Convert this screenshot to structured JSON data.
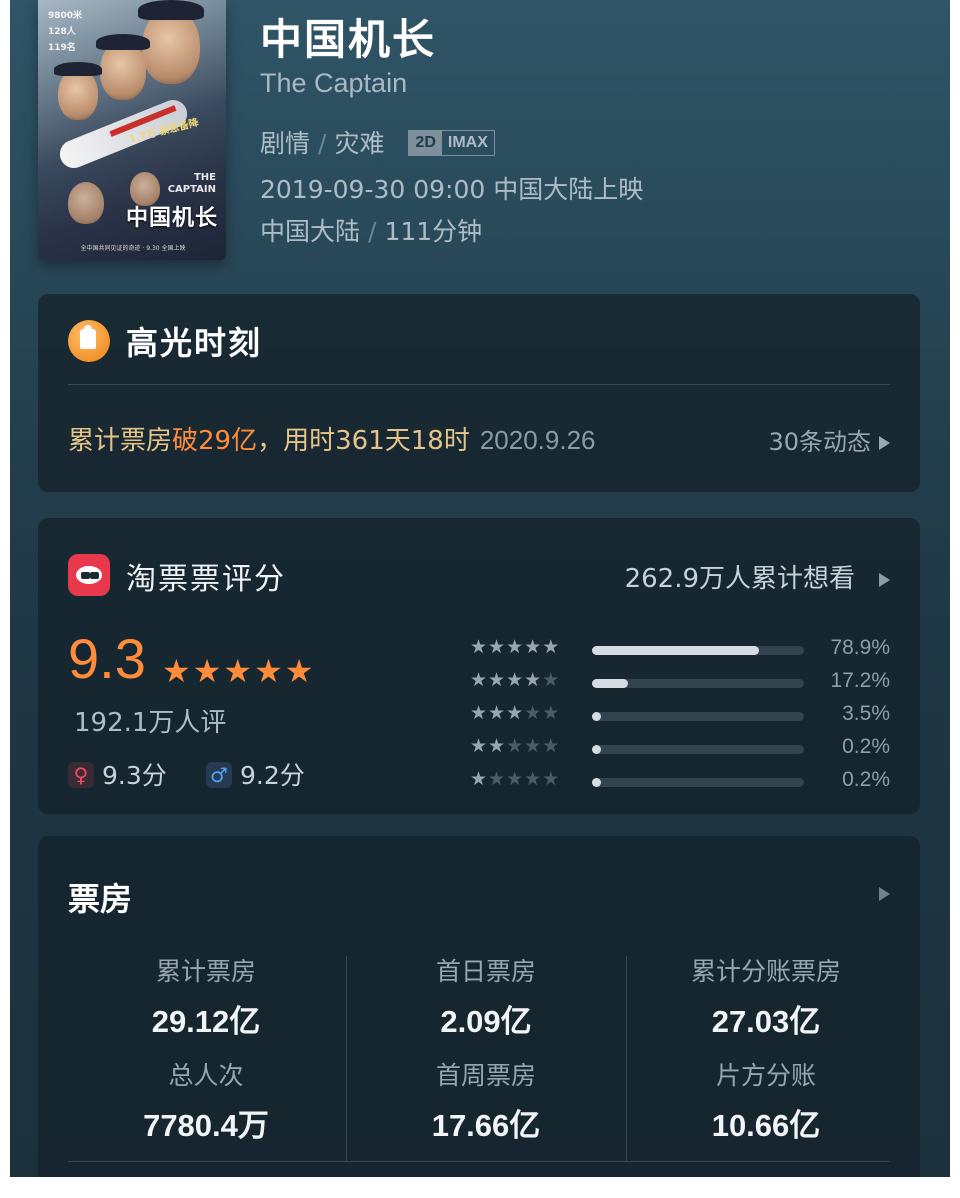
{
  "movie": {
    "title": "中国机长",
    "title_en": "The Captain",
    "genres": [
      "剧情",
      "灾难"
    ],
    "formats": [
      "2D",
      "IMAX"
    ],
    "release": "2019-09-30 09:00 中国大陆上映",
    "region": "中国大陆",
    "duration": "111分钟",
    "poster": {
      "title_cn": "中国机长",
      "title_en_line1": "THE",
      "title_en_line2": "CAPTAIN",
      "tagline": "1.7万 紧急备降",
      "side_text_1": "9800米",
      "side_text_2": "128人",
      "side_text_3": "119名",
      "bottom_text": "全中国共同见证的奇迹 · 9.30 全国上映"
    }
  },
  "highlight": {
    "title": "高光时刻",
    "prefix": "累计票房",
    "milestone": "破29亿",
    "suffix": "，用时361天18时",
    "date": "2020.9.26",
    "more": "30条动态"
  },
  "rating": {
    "title": "淘票票评分",
    "want": "262.9万人累计想看",
    "score": "9.3",
    "raters": "192.1万人评",
    "female_score": "9.3分",
    "male_score": "9.2分",
    "distribution": [
      {
        "stars": 5,
        "value": 0.789,
        "label": "78.9%"
      },
      {
        "stars": 4,
        "value": 0.172,
        "label": "17.2%"
      },
      {
        "stars": 3,
        "value": 0.035,
        "label": "3.5%"
      },
      {
        "stars": 2,
        "value": 0.002,
        "label": "0.2%"
      },
      {
        "stars": 1,
        "value": 0.002,
        "label": "0.2%"
      }
    ]
  },
  "box_office": {
    "title": "票房",
    "cells": [
      {
        "label": "累计票房",
        "value": "29.12亿"
      },
      {
        "label": "首日票房",
        "value": "2.09亿"
      },
      {
        "label": "累计分账票房",
        "value": "27.03亿"
      },
      {
        "label": "总人次",
        "value": "7780.4万"
      },
      {
        "label": "首周票房",
        "value": "17.66亿"
      },
      {
        "label": "片方分账",
        "value": "10.66亿"
      }
    ]
  },
  "colors": {
    "accent_orange": "#ff8c3a",
    "accent_gold": "#e6c489",
    "taopiaopiao_red": "#e8384b",
    "female": "#ef4b5f",
    "male": "#4fa0f2"
  },
  "icons": {
    "highlight": "highlight-badge-icon",
    "taopiaopiao": "taopiaopiao-logo-icon",
    "female": "female-symbol-icon",
    "male": "male-symbol-icon",
    "arrow": "triangle-right-icon"
  }
}
